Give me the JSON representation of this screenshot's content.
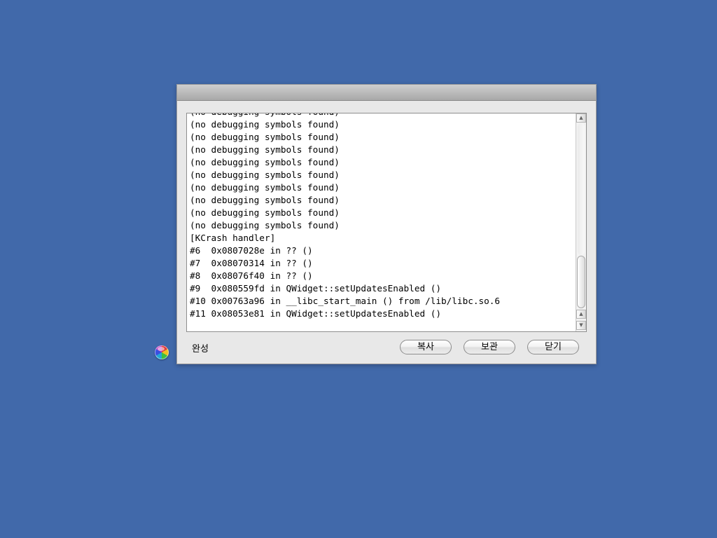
{
  "dialog": {
    "log_lines": [
      "(no debugging symbols found)",
      "(no debugging symbols found)",
      "(no debugging symbols found)",
      "(no debugging symbols found)",
      "(no debugging symbols found)",
      "(no debugging symbols found)",
      "(no debugging symbols found)",
      "(no debugging symbols found)",
      "(no debugging symbols found)",
      "[KCrash handler]",
      "#6  0x0807028e in ?? ()",
      "#7  0x08070314 in ?? ()",
      "#8  0x08076f40 in ?? ()",
      "#9  0x080559fd in QWidget::setUpdatesEnabled ()",
      "#10 0x00763a96 in __libc_start_main () from /lib/libc.so.6",
      "#11 0x08053e81 in QWidget::setUpdatesEnabled ()"
    ],
    "status_text": "완성",
    "buttons": {
      "copy_label": "복사",
      "save_label": "보관",
      "close_label": "닫기"
    }
  },
  "scrollbar": {
    "up_arrow": "▲",
    "down_arrow": "▼"
  },
  "icons": {
    "busy_cursor": "busy-cursor-icon"
  }
}
